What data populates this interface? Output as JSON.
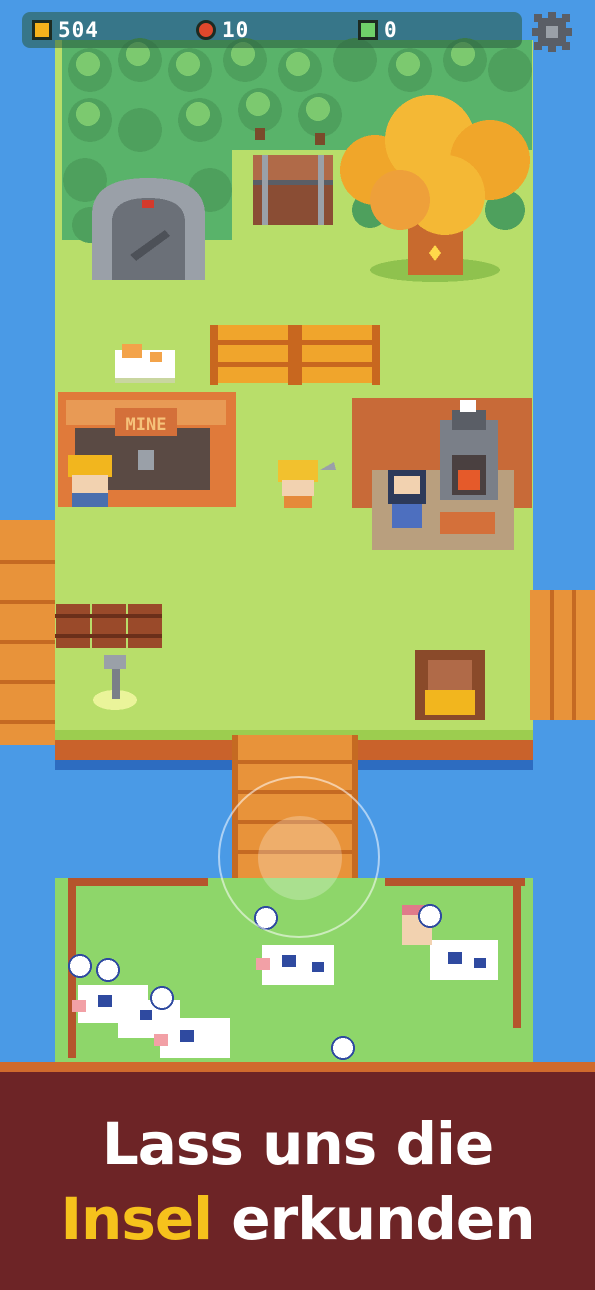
{
  "hud": {
    "coins": "504",
    "apples": "10",
    "gems": "0",
    "coin_icon": "coin-icon",
    "apple_icon": "apple-icon",
    "gem_icon": "gem-icon",
    "settings_icon": "gear-icon"
  },
  "buildings": {
    "mine_sign": "MINE"
  },
  "banner": {
    "line1": "Lass uns die",
    "line2_highlight": "Insel",
    "line2_rest": "erkunden"
  },
  "colors": {
    "water": "#4a9ae6",
    "grass": "#b8de6a",
    "banner": "#6d2426",
    "highlight": "#f6c21c"
  }
}
